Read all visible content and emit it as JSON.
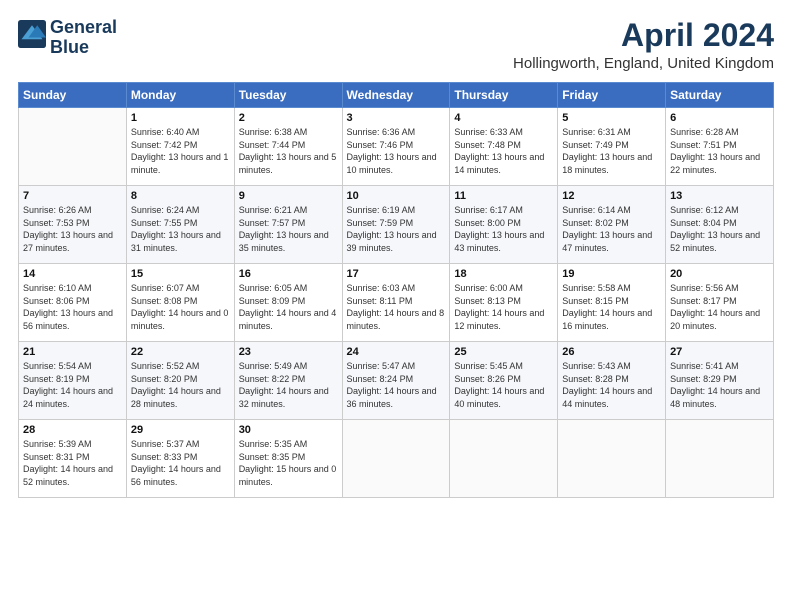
{
  "header": {
    "logo_line1": "General",
    "logo_line2": "Blue",
    "month_title": "April 2024",
    "location": "Hollingworth, England, United Kingdom"
  },
  "weekdays": [
    "Sunday",
    "Monday",
    "Tuesday",
    "Wednesday",
    "Thursday",
    "Friday",
    "Saturday"
  ],
  "weeks": [
    [
      {
        "day": null
      },
      {
        "day": "1",
        "sunrise": "6:40 AM",
        "sunset": "7:42 PM",
        "daylight": "13 hours and 1 minute."
      },
      {
        "day": "2",
        "sunrise": "6:38 AM",
        "sunset": "7:44 PM",
        "daylight": "13 hours and 5 minutes."
      },
      {
        "day": "3",
        "sunrise": "6:36 AM",
        "sunset": "7:46 PM",
        "daylight": "13 hours and 10 minutes."
      },
      {
        "day": "4",
        "sunrise": "6:33 AM",
        "sunset": "7:48 PM",
        "daylight": "13 hours and 14 minutes."
      },
      {
        "day": "5",
        "sunrise": "6:31 AM",
        "sunset": "7:49 PM",
        "daylight": "13 hours and 18 minutes."
      },
      {
        "day": "6",
        "sunrise": "6:28 AM",
        "sunset": "7:51 PM",
        "daylight": "13 hours and 22 minutes."
      }
    ],
    [
      {
        "day": "7",
        "sunrise": "6:26 AM",
        "sunset": "7:53 PM",
        "daylight": "13 hours and 27 minutes."
      },
      {
        "day": "8",
        "sunrise": "6:24 AM",
        "sunset": "7:55 PM",
        "daylight": "13 hours and 31 minutes."
      },
      {
        "day": "9",
        "sunrise": "6:21 AM",
        "sunset": "7:57 PM",
        "daylight": "13 hours and 35 minutes."
      },
      {
        "day": "10",
        "sunrise": "6:19 AM",
        "sunset": "7:59 PM",
        "daylight": "13 hours and 39 minutes."
      },
      {
        "day": "11",
        "sunrise": "6:17 AM",
        "sunset": "8:00 PM",
        "daylight": "13 hours and 43 minutes."
      },
      {
        "day": "12",
        "sunrise": "6:14 AM",
        "sunset": "8:02 PM",
        "daylight": "13 hours and 47 minutes."
      },
      {
        "day": "13",
        "sunrise": "6:12 AM",
        "sunset": "8:04 PM",
        "daylight": "13 hours and 52 minutes."
      }
    ],
    [
      {
        "day": "14",
        "sunrise": "6:10 AM",
        "sunset": "8:06 PM",
        "daylight": "13 hours and 56 minutes."
      },
      {
        "day": "15",
        "sunrise": "6:07 AM",
        "sunset": "8:08 PM",
        "daylight": "14 hours and 0 minutes."
      },
      {
        "day": "16",
        "sunrise": "6:05 AM",
        "sunset": "8:09 PM",
        "daylight": "14 hours and 4 minutes."
      },
      {
        "day": "17",
        "sunrise": "6:03 AM",
        "sunset": "8:11 PM",
        "daylight": "14 hours and 8 minutes."
      },
      {
        "day": "18",
        "sunrise": "6:00 AM",
        "sunset": "8:13 PM",
        "daylight": "14 hours and 12 minutes."
      },
      {
        "day": "19",
        "sunrise": "5:58 AM",
        "sunset": "8:15 PM",
        "daylight": "14 hours and 16 minutes."
      },
      {
        "day": "20",
        "sunrise": "5:56 AM",
        "sunset": "8:17 PM",
        "daylight": "14 hours and 20 minutes."
      }
    ],
    [
      {
        "day": "21",
        "sunrise": "5:54 AM",
        "sunset": "8:19 PM",
        "daylight": "14 hours and 24 minutes."
      },
      {
        "day": "22",
        "sunrise": "5:52 AM",
        "sunset": "8:20 PM",
        "daylight": "14 hours and 28 minutes."
      },
      {
        "day": "23",
        "sunrise": "5:49 AM",
        "sunset": "8:22 PM",
        "daylight": "14 hours and 32 minutes."
      },
      {
        "day": "24",
        "sunrise": "5:47 AM",
        "sunset": "8:24 PM",
        "daylight": "14 hours and 36 minutes."
      },
      {
        "day": "25",
        "sunrise": "5:45 AM",
        "sunset": "8:26 PM",
        "daylight": "14 hours and 40 minutes."
      },
      {
        "day": "26",
        "sunrise": "5:43 AM",
        "sunset": "8:28 PM",
        "daylight": "14 hours and 44 minutes."
      },
      {
        "day": "27",
        "sunrise": "5:41 AM",
        "sunset": "8:29 PM",
        "daylight": "14 hours and 48 minutes."
      }
    ],
    [
      {
        "day": "28",
        "sunrise": "5:39 AM",
        "sunset": "8:31 PM",
        "daylight": "14 hours and 52 minutes."
      },
      {
        "day": "29",
        "sunrise": "5:37 AM",
        "sunset": "8:33 PM",
        "daylight": "14 hours and 56 minutes."
      },
      {
        "day": "30",
        "sunrise": "5:35 AM",
        "sunset": "8:35 PM",
        "daylight": "15 hours and 0 minutes."
      },
      {
        "day": null
      },
      {
        "day": null
      },
      {
        "day": null
      },
      {
        "day": null
      }
    ]
  ]
}
